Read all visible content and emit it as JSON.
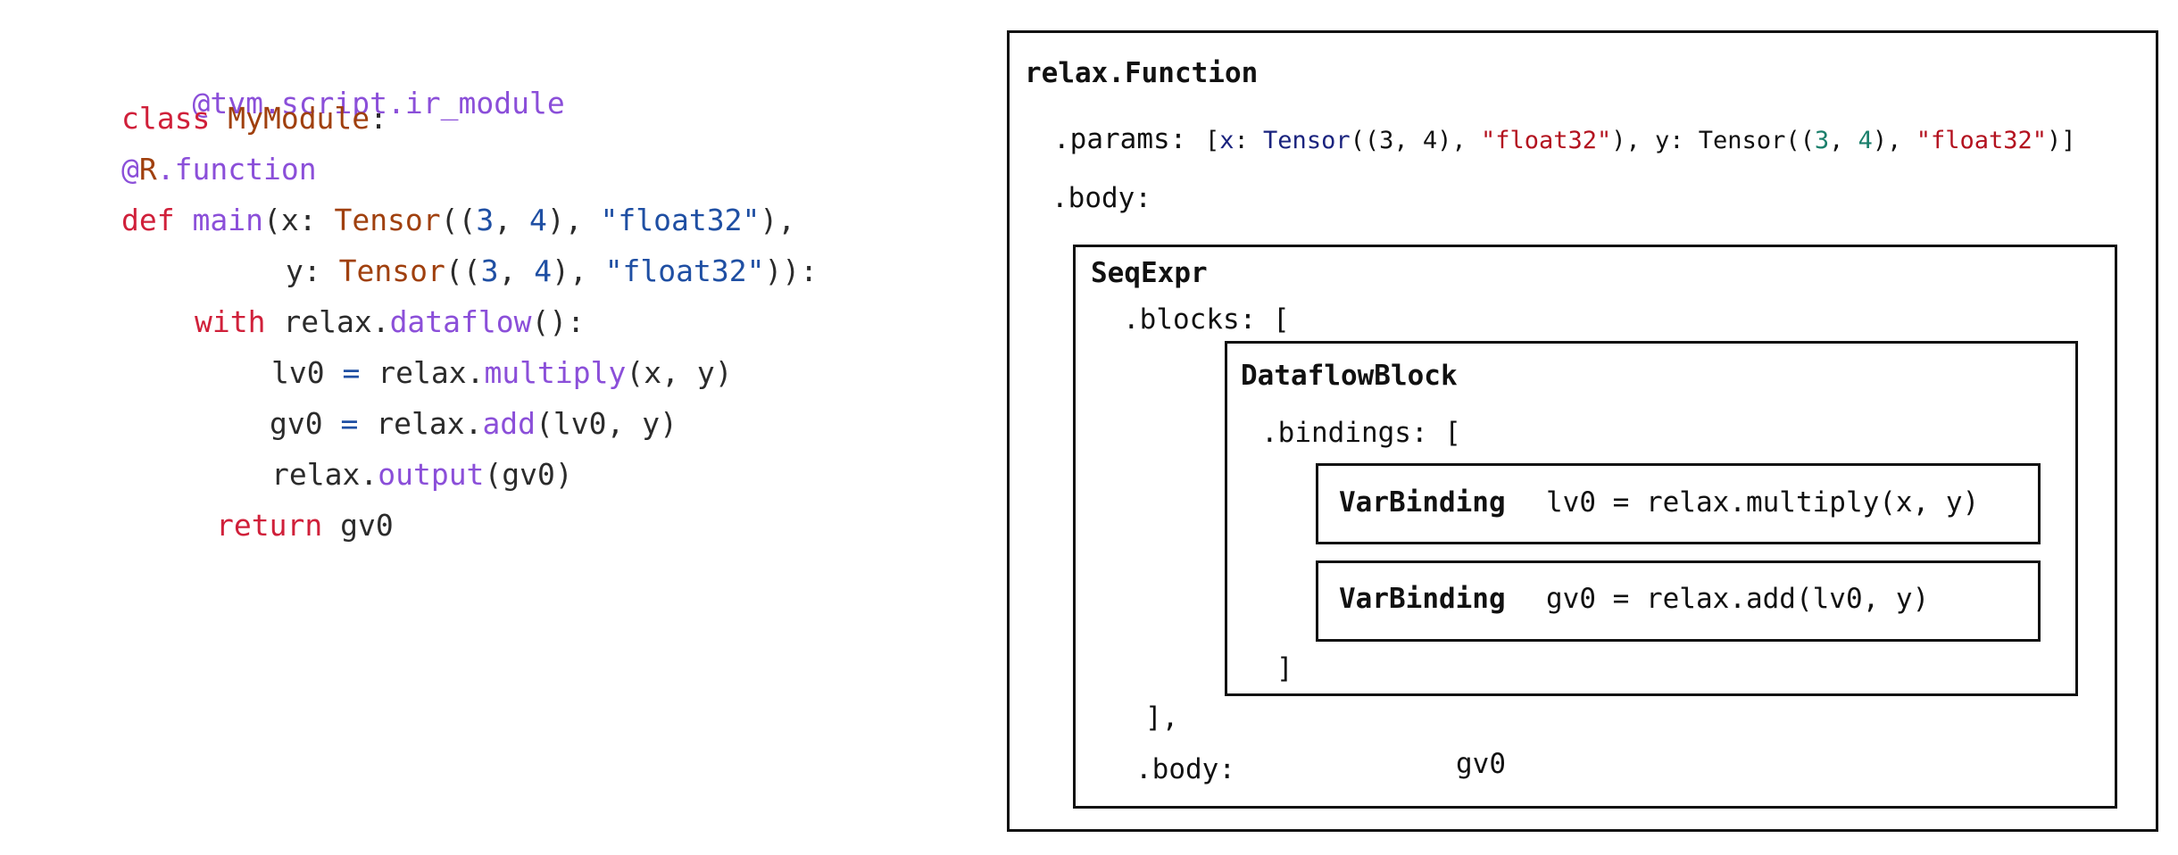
{
  "code": {
    "decorator1": "@tvm.script.ir_module",
    "class_kw": "class",
    "class_name": "MyModule",
    "class_colon": ":",
    "decorator2_at": "@",
    "decorator2_R": "R",
    "decorator2_rest": ".function",
    "def_kw": "def",
    "func_name": "main",
    "line4_a": "(x: ",
    "tensor_kw": "Tensor",
    "paren_open": "((",
    "num3": "3",
    "comma_sp": ", ",
    "num4": "4",
    "tuple_close": "), ",
    "dtype": "\"float32\"",
    "line4_end": "),",
    "line5_a": "y: ",
    "line5_end": ")):",
    "with_kw": "with",
    "line6_mid": " relax.",
    "dataflow_fn": "dataflow",
    "line6_end": "():",
    "lv0": "lv0 ",
    "eq": "=",
    "relax_dot": " relax.",
    "multiply_fn": "multiply",
    "line7_end": "(x, y)",
    "gv0": "gv0 ",
    "add_fn": "add",
    "line8_end": "(lv0, y)",
    "relax_out": "relax.",
    "output_fn": "output",
    "line9_end": "(gv0)",
    "return_kw": "return",
    "return_val": " gv0"
  },
  "diagram": {
    "function_title": "relax.Function",
    "params_label": ".params:",
    "params_value": {
      "open": "[",
      "x": "x",
      "colon": ": ",
      "tensor": "Tensor",
      "tuple_open": "((",
      "n3": "3",
      "sep": ", ",
      "n4": "4",
      "tuple_close": "), ",
      "dtype": "\"float32\"",
      "mid": "), y: ",
      "end": ")]"
    },
    "body_label": ".body:",
    "seqexpr_title": "SeqExpr",
    "blocks_label": ".blocks: [",
    "dataflow_title": "DataflowBlock",
    "bindings_label": ".bindings: [",
    "bindings": [
      {
        "kind": "VarBinding",
        "expr": "lv0 = relax.multiply(x, y)"
      },
      {
        "kind": "VarBinding",
        "expr": "gv0 = relax.add(lv0, y)"
      }
    ],
    "bindings_close": "]",
    "blocks_close": "],",
    "seq_body_label": ".body:",
    "seq_body_value": "gv0"
  }
}
